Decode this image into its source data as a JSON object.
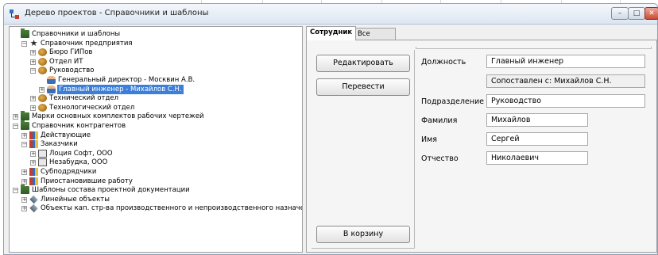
{
  "window": {
    "title": "Дерево проектов - Справочники и шаблоны",
    "minimize_glyph": "–",
    "maximize_glyph": "□",
    "close_glyph": "✕"
  },
  "tree": {
    "nodes": [
      {
        "label": "Справочники и шаблоны",
        "icon": "folder-icon",
        "expander": "",
        "level": 0
      },
      {
        "label": "Справочник предприятия",
        "icon": "star-icon",
        "expander": "−",
        "level": 1
      },
      {
        "label": "Бюро ГИПов",
        "icon": "department-icon",
        "expander": "+",
        "level": 2
      },
      {
        "label": "Отдел ИТ",
        "icon": "department-icon",
        "expander": "+",
        "level": 2
      },
      {
        "label": "Руководство",
        "icon": "department-icon",
        "expander": "−",
        "level": 2
      },
      {
        "label": "Генеральный директор - Москвин А.В.",
        "icon": "person-icon",
        "expander": "",
        "level": 3
      },
      {
        "label": "Главный инженер - Михайлов С.Н.",
        "icon": "person-icon",
        "expander": "+",
        "level": 3,
        "selected": true
      },
      {
        "label": "Технический отдел",
        "icon": "department-icon",
        "expander": "+",
        "level": 2
      },
      {
        "label": "Технологический отдел",
        "icon": "department-icon",
        "expander": "+",
        "level": 2
      },
      {
        "label": "Марки основных комплектов рабочих чертежей",
        "icon": "folder-icon",
        "expander": "+",
        "level": 0
      },
      {
        "label": "Справочник контрагентов",
        "icon": "folder-icon",
        "expander": "−",
        "level": 0
      },
      {
        "label": "Действующие",
        "icon": "books-icon",
        "expander": "+",
        "level": 1
      },
      {
        "label": "Заказчики",
        "icon": "books-icon",
        "expander": "−",
        "level": 1
      },
      {
        "label": "Лоция Софт, ООО",
        "icon": "building-icon",
        "expander": "+",
        "level": 2
      },
      {
        "label": "Незабудка, ООО",
        "icon": "building-icon",
        "expander": "+",
        "level": 2
      },
      {
        "label": "Субподрядчики",
        "icon": "books-icon",
        "expander": "+",
        "level": 1
      },
      {
        "label": "Приостановившие работу",
        "icon": "books-icon",
        "expander": "+",
        "level": 1
      },
      {
        "label": "Шаблоны состава проектной документации",
        "icon": "folder-icon",
        "expander": "−",
        "level": 0
      },
      {
        "label": "Линейные объекты",
        "icon": "diamond-icon",
        "expander": "+",
        "level": 1
      },
      {
        "label": "Объекты кап. стр-ва производственного и непроизводственного назначения",
        "icon": "diamond-icon",
        "expander": "+",
        "level": 1
      }
    ]
  },
  "tabs": [
    {
      "label": "Сотрудник",
      "active": true
    },
    {
      "label": "Все атрибуты",
      "active": false
    }
  ],
  "actions": {
    "edit": "Редактировать",
    "transfer": "Перевести",
    "trash": "В корзину"
  },
  "fields": {
    "position_label": "Должность",
    "position_value": "Главный инженер",
    "mapped_value": "Сопоставлен с: Михайлов С.Н.",
    "division_label": "Подразделение",
    "division_value": "Руководство",
    "lastname_label": "Фамилия",
    "lastname_value": "Михайлов",
    "firstname_label": "Имя",
    "firstname_value": "Сергей",
    "patronymic_label": "Отчество",
    "patronymic_value": "Николаевич"
  }
}
